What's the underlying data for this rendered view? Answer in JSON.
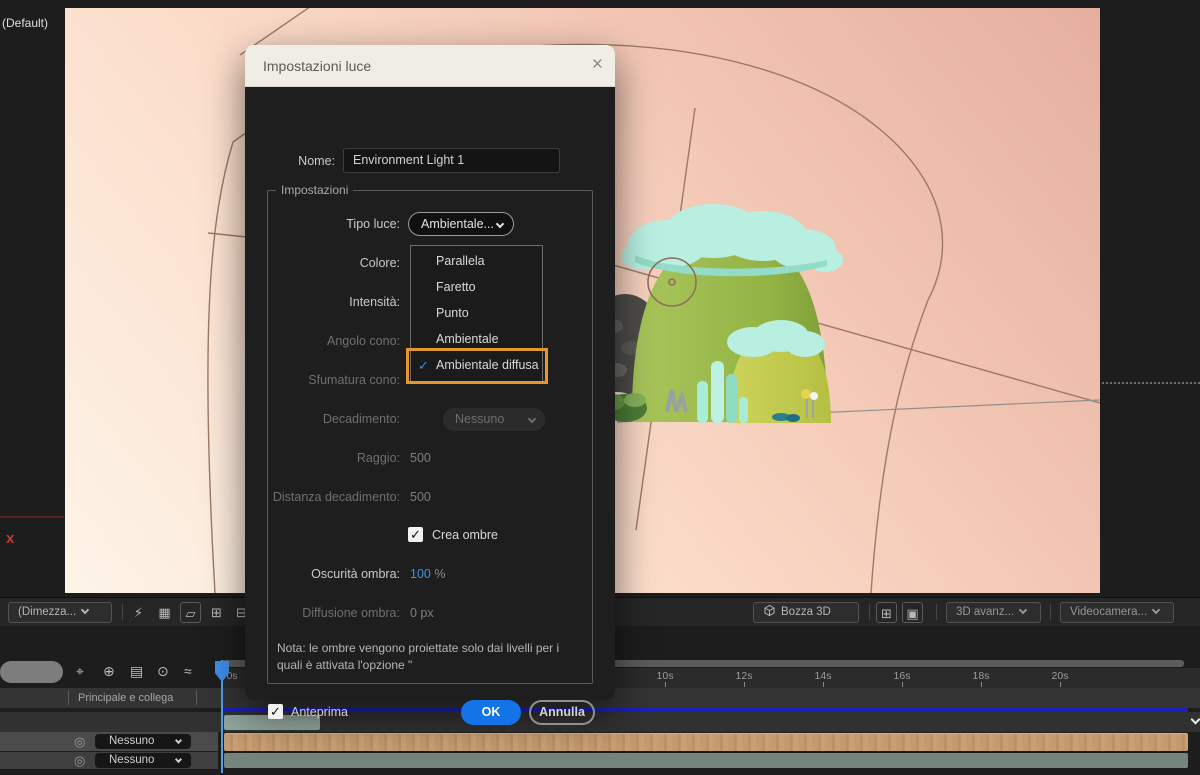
{
  "window": {
    "preset_label": "(Default)",
    "axis_x_label": "x"
  },
  "dialog": {
    "title": "Impostazioni luce",
    "close_glyph": "×",
    "name_label": "Nome:",
    "name_value": "Environment Light 1",
    "group_label": "Impostazioni",
    "rows": {
      "tipo_luce_label": "Tipo luce:",
      "tipo_luce_value": "Ambientale...",
      "colore_label": "Colore:",
      "intensita_label": "Intensità:",
      "angolo_label": "Angolo cono:",
      "sfumatura_label": "Sfumatura cono:",
      "decadimento_label": "Decadimento:",
      "decadimento_value": "Nessuno",
      "raggio_label": "Raggio:",
      "raggio_value": "500",
      "distanza_label": "Distanza decadimento:",
      "distanza_value": "500",
      "crea_ombre_label": "Crea ombre",
      "oscurita_label": "Oscurità ombra:",
      "oscurita_value": "100",
      "oscurita_unit": "%",
      "diffusione_label": "Diffusione ombra:",
      "diffusione_value": "0 px"
    },
    "menu": {
      "items": [
        {
          "label": "Parallela"
        },
        {
          "label": "Faretto"
        },
        {
          "label": "Punto"
        },
        {
          "label": "Ambientale"
        },
        {
          "label": "Ambientale diffusa",
          "check": "✓"
        }
      ]
    },
    "note_line1": "Nota: le ombre vengono proiettate solo dai livelli per i",
    "note_line2": "quali è attivata l'opzione \"",
    "anteprima_label": "Anteprima",
    "ok_label": "OK",
    "annulla_label": "Annulla",
    "check_glyph": "✓",
    "accent_orange": "#e6962e",
    "accent_blue": "#1473e6",
    "checkmark_blue": "#3a8ee6"
  },
  "toolbar": {
    "magnification_value": "(Dimezza...",
    "fast_preview_icon": "⚡",
    "grid_icon": "▦",
    "roi_icon": "▱",
    "guides_icon": "⊞",
    "mask_icon": "⊟",
    "bozza_label": "Bozza 3D",
    "views_icon": "⊞",
    "ground_icon": "▣",
    "avanz_value": "3D avanz...",
    "camera_value": "Videocamera..."
  },
  "timeline": {
    "ruler_ticks": [
      {
        "label": "0s"
      },
      {
        "label": "10s"
      },
      {
        "label": "12s"
      },
      {
        "label": "14s"
      },
      {
        "label": "16s"
      },
      {
        "label": "18s"
      },
      {
        "label": "20s"
      }
    ],
    "header_label": "Principale e collega",
    "icons": [
      {
        "glyph": "⌖"
      },
      {
        "glyph": "⊕"
      },
      {
        "glyph": "▤"
      },
      {
        "glyph": "⊙"
      },
      {
        "glyph": "≈"
      }
    ],
    "spiral_glyph": "◎",
    "rows": [
      {
        "parent_value": "Nessuno"
      },
      {
        "parent_value": "Nessuno"
      }
    ]
  }
}
